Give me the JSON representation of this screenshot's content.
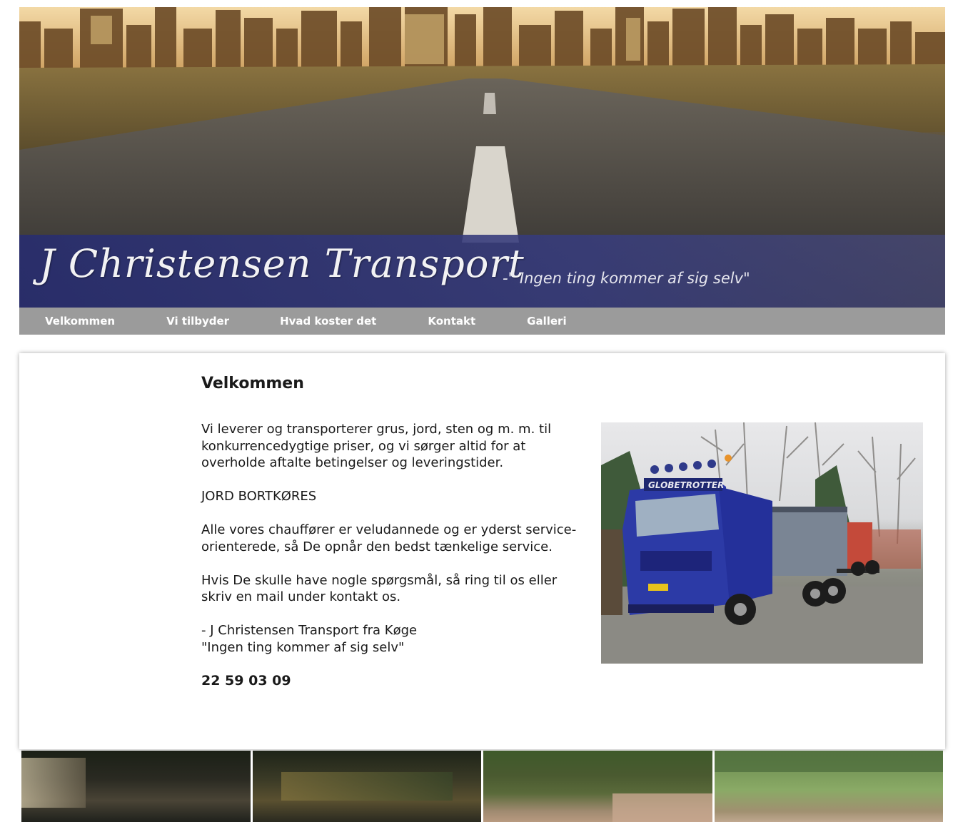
{
  "brand": {
    "name": "J Christensen Transport",
    "slogan": "-\" Ingen ting kommer af sig selv\""
  },
  "nav": {
    "items": [
      {
        "label": "Velkommen"
      },
      {
        "label": "Vi tilbyder"
      },
      {
        "label": "Hvad koster det"
      },
      {
        "label": "Kontakt"
      },
      {
        "label": "Galleri"
      }
    ]
  },
  "main": {
    "heading": "Velkommen",
    "intro": "Vi leverer og transporterer grus, jord, sten og m. m. til konkurrencedygtige priser, og vi sørger altid for at overholde aftalte betingelser og leveringstider.",
    "notice": "JORD BORTKØRES",
    "staff": "Alle vores chauffører er veludannede og er yderst service-orienterede, så De opnår den bedst tænkelige service.",
    "contact": "Hvis De skulle have nogle spørgsmål, så ring til os eller skriv en mail under kontakt os.",
    "signature_line1": "- J Christensen Transport fra Køge",
    "signature_line2": "\"Ingen ting kommer af sig selv\"",
    "phone": "22 59 03 09"
  },
  "truck_photo": {
    "cab_text": "GLOBETROTTER"
  },
  "colors": {
    "nav_bg": "#9b9b9b",
    "title_strip": "#2d3270",
    "truck_blue": "#2c3aa6"
  }
}
